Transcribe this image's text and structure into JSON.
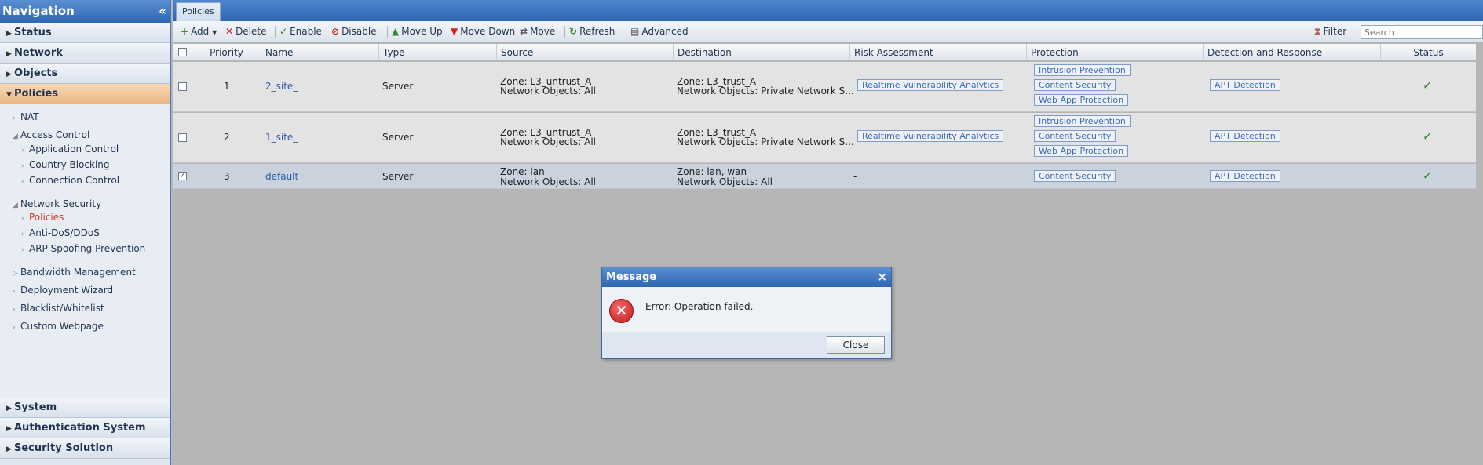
{
  "nav": {
    "title": "Navigation",
    "collapse_icon": "«",
    "sections_top": [
      "Status",
      "Network",
      "Objects",
      "Policies"
    ],
    "tree": [
      "NAT",
      "Access Control",
      "Application Control",
      "Country Blocking",
      "Connection Control",
      "Network Security",
      "Policies",
      "Anti-DoS/DDoS",
      "ARP Spoofing Prevention",
      "Bandwidth Management",
      "Deployment Wizard",
      "Blacklist/Whitelist",
      "Custom Webpage"
    ],
    "sections_bottom": [
      "System",
      "Authentication System",
      "Security Solution"
    ]
  },
  "tab": {
    "label": "Policies"
  },
  "toolbar": {
    "add": "Add",
    "delete": "Delete",
    "enable": "Enable",
    "disable": "Disable",
    "move_up": "Move Up",
    "move_down": "Move Down",
    "move": "Move",
    "refresh": "Refresh",
    "advanced": "Advanced",
    "filter": "Filter",
    "search_placeholder": "Search"
  },
  "columns": [
    "Priority",
    "Name",
    "Type",
    "Source",
    "Destination",
    "Risk Assessment",
    "Protection",
    "Detection and Response",
    "Status"
  ],
  "rows": [
    {
      "checked": false,
      "priority": "1",
      "name": "2_site_",
      "type": "Server",
      "source_zone": "Zone: L3_untrust_A",
      "source_objects": "Network Objects: All",
      "dest_zone": "Zone: L3_trust_A",
      "dest_objects": "Network Objects: Private Network S...",
      "risk": "Realtime Vulnerability Analytics",
      "protection": [
        "Intrusion Prevention",
        "Content Security",
        "Web App Protection"
      ],
      "detection": "APT Detection",
      "status": "✓"
    },
    {
      "checked": false,
      "priority": "2",
      "name": "1_site_",
      "type": "Server",
      "source_zone": "Zone: L3_untrust_A",
      "source_objects": "Network Objects: All",
      "dest_zone": "Zone: L3_trust_A",
      "dest_objects": "Network Objects: Private Network S...",
      "risk": "Realtime Vulnerability Analytics",
      "protection": [
        "Intrusion Prevention",
        "Content Security",
        "Web App Protection"
      ],
      "detection": "APT Detection",
      "status": "✓"
    },
    {
      "checked": true,
      "priority": "3",
      "name": "default",
      "type": "Server",
      "source_zone": "Zone: lan",
      "source_objects": "Network Objects: All",
      "dest_zone": "Zone: lan, wan",
      "dest_objects": "Network Objects: All",
      "risk": "-",
      "protection": [
        "Content Security"
      ],
      "detection": "APT Detection",
      "status": "✓"
    }
  ],
  "dialog": {
    "title": "Message",
    "close_x": "×",
    "error_icon": "✕",
    "message": "Error: Operation failed.",
    "button": "Close"
  }
}
